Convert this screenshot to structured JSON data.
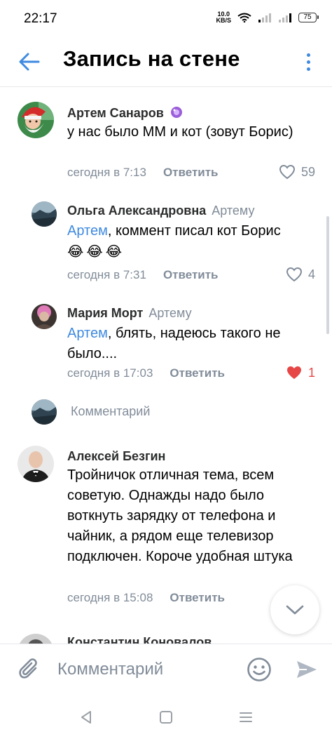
{
  "status": {
    "time": "22:17",
    "net_speed_value": "10.0",
    "net_speed_unit": "KB/S",
    "battery": "75"
  },
  "header": {
    "title": "Запись на стене"
  },
  "comments": [
    {
      "author": "Артем Санаров",
      "reply_to": "",
      "mention": "",
      "text": "у нас было ММ и кот (зовут Борис)",
      "time": "сегодня в 7:13",
      "reply_label": "Ответить",
      "likes": "59",
      "liked": false
    },
    {
      "author": "Ольга Александровна",
      "reply_to": "Артему",
      "mention": "Артем",
      "text": ", коммент писал кот Борис",
      "emoji": "😂😂😂",
      "time": "сегодня в 7:31",
      "reply_label": "Ответить",
      "likes": "4",
      "liked": false
    },
    {
      "author": "Мария Морт",
      "reply_to": "Артему",
      "mention": "Артем",
      "text": ", блять, надеюсь такого не было....",
      "time": "сегодня в 17:03",
      "reply_label": "Ответить",
      "likes": "1",
      "liked": true
    },
    {
      "author": "Алексей Безгин",
      "reply_to": "",
      "mention": "",
      "text": "Тройничок отличная тема, всем советую. Однажды надо было воткнуть зарядку от телефона и чайник, а рядом еще телевизор подключен. Короче удобная штука",
      "time": "сегодня в 15:08",
      "reply_label": "Ответить",
      "likes": "",
      "liked": false
    },
    {
      "author": "Константин Коновалов"
    }
  ],
  "thread_reply_prompt": "Комментарий",
  "compose": {
    "placeholder": "Комментарий"
  },
  "colors": {
    "accent": "#3f8ae0",
    "secondary": "#818c99",
    "like_red": "#e64646"
  }
}
